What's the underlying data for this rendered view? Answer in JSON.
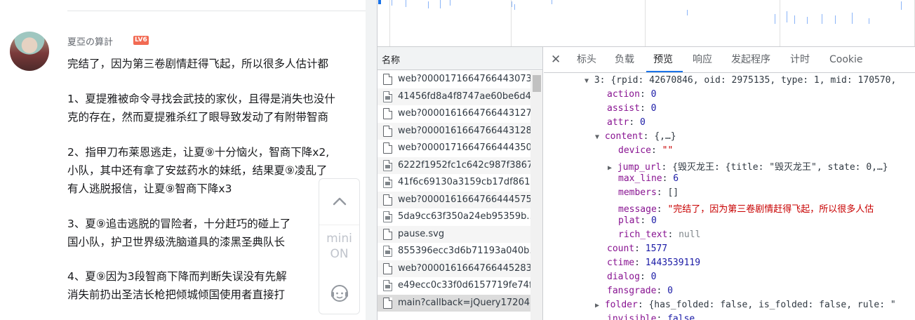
{
  "comment": {
    "username": "夏亞の算計",
    "level_badge": "LV6",
    "lines": [
      "完结了，因为第三卷剧情赶得飞起，所以很多人估计都",
      "1、夏提雅被命令寻找会武技的家伙，且得是消失也没什",
      "克的存在，然而夏提雅杀红了眼导致发动了有附带智商",
      "2、指甲刀布莱恩逃走，让夏⑨十分恼火，智商下降x2,",
      "小队，其中还有拿了安兹药水的妹纸，结果夏⑨凌乱了",
      "有人逃脱报信，让夏⑨智商下降x3",
      "3、夏⑨追击逃脱的冒险者，十分赶巧的碰上了",
      "国小队，护卫世界级洗脑道具的漆黑圣典队长",
      "4、夏⑨因为3段智商下降而判断失误没有先解",
      "消失前扔出圣洁长枪把倾城倾国使用者直接打"
    ],
    "float_bar": {
      "mini_label_1": "mini",
      "mini_label_2": "ON"
    }
  },
  "devtools": {
    "name_header": "名称",
    "requests": [
      {
        "label": "web?0000171664766443073",
        "icon": "doc-icon"
      },
      {
        "label": "41456fd8a4f8747ae60be6d4",
        "icon": "image-file-icon"
      },
      {
        "label": "web?0000161664766443127",
        "icon": "doc-icon"
      },
      {
        "label": "web?0000161664766443128",
        "icon": "doc-icon"
      },
      {
        "label": "web?0000171664766444350",
        "icon": "doc-icon"
      },
      {
        "label": "6222f1952fc1c642c987f3867",
        "icon": "image-file-icon"
      },
      {
        "label": "41f6c69130a3159cb17df861.",
        "icon": "image-file-icon"
      },
      {
        "label": "web?0000161664766444575",
        "icon": "doc-icon"
      },
      {
        "label": "5da9cc63f350a24eb95359b..",
        "icon": "image-file-icon"
      },
      {
        "label": "pause.svg",
        "icon": "svg-file-icon"
      },
      {
        "label": "855396ecc3d6b71193a040b.",
        "icon": "image-file-icon"
      },
      {
        "label": "web?0000161664766445283",
        "icon": "doc-icon"
      },
      {
        "label": "e49ecc0c33f0d6157719fe74f",
        "icon": "image-file-icon"
      },
      {
        "label": "main?callback=jQuery17204",
        "icon": "doc-icon"
      }
    ],
    "tabs": [
      "标头",
      "负载",
      "预览",
      "响应",
      "发起程序",
      "计时",
      "Cookie"
    ],
    "active_tab": "预览",
    "tree": {
      "header_line": "3: {rpid: 42670846, oid: 2975135, type: 1, mid: 170570,",
      "action": "0",
      "assist": "0",
      "attr": "0",
      "content": "{,…}",
      "device": "\"\"",
      "jump_url": "{毁灭龙王: {title: \"毁灭龙王\", state: 0,…}",
      "max_line": "6",
      "members": "[]",
      "message": "\"完结了，因为第三卷剧情赶得飞起，所以很多人估",
      "plat": "0",
      "rich_text": "null",
      "count": "1577",
      "ctime": "1443539119",
      "dialog": "0",
      "fansgrade": "0",
      "folder": "{has_folded: false, is_folded: false, rule: \"",
      "invisible": "false"
    }
  }
}
